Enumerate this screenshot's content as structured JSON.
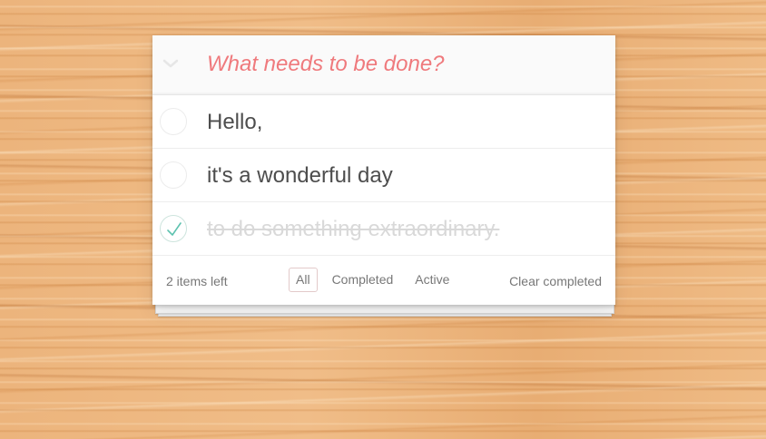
{
  "new_todo": {
    "placeholder": "What needs to be done?",
    "toggle_all_icon": "chevron-down-icon"
  },
  "todos": [
    {
      "label": "Hello,",
      "completed": false
    },
    {
      "label": "it's a wonderful day",
      "completed": false
    },
    {
      "label": "to do something extraordinary.",
      "completed": true
    }
  ],
  "footer": {
    "count_text": "2 items left",
    "filters": [
      {
        "label": "All",
        "selected": true
      },
      {
        "label": "Completed",
        "selected": false
      },
      {
        "label": "Active",
        "selected": false
      }
    ],
    "clear_completed": "Clear completed"
  },
  "colors": {
    "placeholder": "#ef7a7d",
    "check": "#5dc2af",
    "completed_text": "#d9d9d9",
    "text": "#4d4d4d",
    "background_wood": "#eab27a"
  }
}
